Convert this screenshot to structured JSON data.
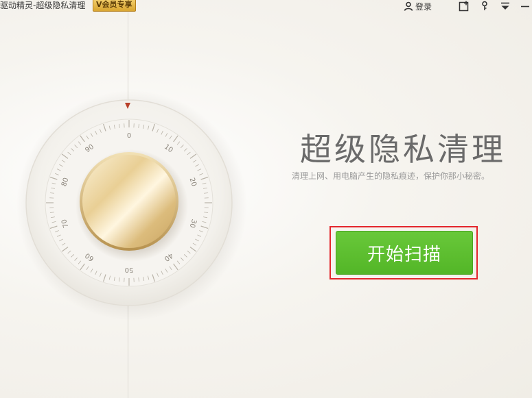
{
  "titlebar": {
    "app_title": "驱动精灵-超级隐私清理",
    "vip_badge": "V会员专享",
    "login_label": "登录"
  },
  "icons": [
    "user-icon",
    "add-window-icon",
    "key-icon",
    "menu-icon",
    "minimize-icon",
    "triangle-pointer-icon"
  ],
  "dial": {
    "labels": [
      "0",
      "10",
      "20",
      "30",
      "40",
      "50",
      "60",
      "70",
      "80",
      "90"
    ]
  },
  "main": {
    "headline": "超级隐私清理",
    "subtitle": "清理上网、用电脑产生的隐私痕迹，保护你那小秘密。",
    "scan_button_label": "开始扫描"
  },
  "colors": {
    "button_green": "#5cbf2e",
    "highlight_red": "#e3262c",
    "pointer_red": "#b8402a"
  }
}
